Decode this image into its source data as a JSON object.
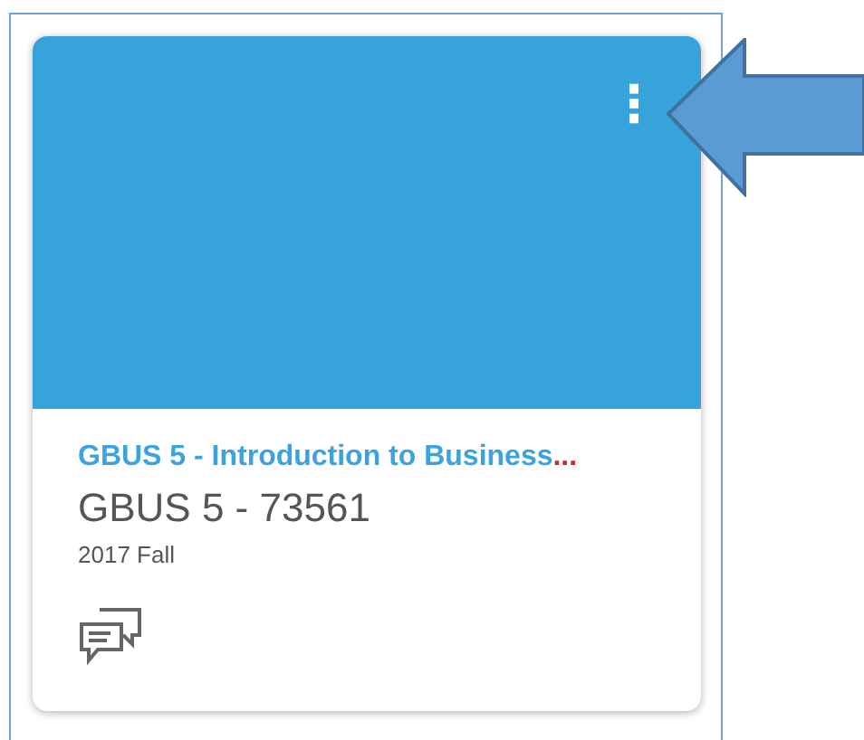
{
  "course_card": {
    "menu_icon": "⋮",
    "title": "GBUS 5 - Introduction to Business",
    "title_overflow": "...",
    "code": "GBUS 5 - 73561",
    "term": "2017 Fall"
  }
}
